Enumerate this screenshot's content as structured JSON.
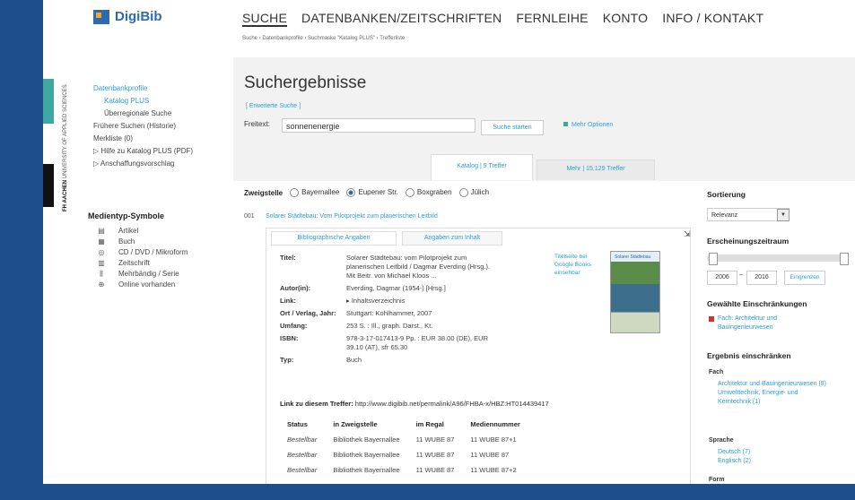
{
  "logo": {
    "text": "DigiBib"
  },
  "nav": {
    "items": [
      "SUCHE",
      "DATENBANKEN/ZEITSCHRIFTEN",
      "FERNLEIHE",
      "KONTO",
      "INFO / KONTAKT"
    ],
    "breadcrumb": "Suche › Datenbankprofile › Suchmaske \"Katalog PLUS\" › Trefferliste"
  },
  "sidebar": {
    "vertical_label": "UNIVERSITY OF APPLIED SCIENCES",
    "vertical_fh": "FH AACHEN",
    "links": [
      {
        "label": "Datenbankprofile",
        "style": "lnk"
      },
      {
        "label": "Katalog PLUS",
        "style": "lnk indent"
      },
      {
        "label": "Überregionale Suche",
        "style": "dark indent"
      },
      {
        "label": "Frühere Suchen (Historie)",
        "style": "dark"
      },
      {
        "label": "Merkliste (0)",
        "style": "dark"
      },
      {
        "label": "▷ Hilfe zu Katalog PLUS (PDF)",
        "style": "dark"
      },
      {
        "label": "▷ Anschaffungsvorschlag",
        "style": "dark"
      }
    ],
    "media_title": "Medientyp-Symbole",
    "media": [
      {
        "icon": "▤",
        "label": "Artikel"
      },
      {
        "icon": "▦",
        "label": "Buch"
      },
      {
        "icon": "◎",
        "label": "CD / DVD / Mikroform"
      },
      {
        "icon": "▥",
        "label": "Zeitschrift"
      },
      {
        "icon": "⫼",
        "label": "Mehrbändig / Serie"
      },
      {
        "icon": "⊕",
        "label": "Online vorhanden"
      }
    ]
  },
  "main": {
    "title": "Suchergebnisse",
    "extended_link": "[ Erweiterte Suche ]",
    "freitext_label": "Freitext:",
    "freitext_value": "sonnenenergie",
    "search_button": "Suche starten",
    "more_options": "Mehr Optionen",
    "tab_katalog": "Katalog | 9 Treffer",
    "tab_mehr": "Mehr | 15.129 Treffer",
    "zweig_label": "Zweigstelle",
    "branches": [
      {
        "label": "Bayernallee",
        "checked": false
      },
      {
        "label": "Eupener Str.",
        "checked": true
      },
      {
        "label": "Boxgraben",
        "checked": false
      },
      {
        "label": "Jülich",
        "checked": false
      }
    ]
  },
  "result": {
    "number": "001",
    "title": "Solarer Städtebau: Vom Pilotprojekt zum planerischen Leitbild",
    "subtab_biblio": "Bibliographische Angaben",
    "subtab_inhalt": "Angaben zum Inhalt",
    "inhalt_link": "Titelseite bei Google Books einsehbar",
    "cover_title": "Solarer Städtebau",
    "details": [
      {
        "label": "Titel:",
        "value": "Solarer Städtebau: vom Pilotprojekt zum planerischen Leitbild / Dagmar Everding (Hrsg.). Mit Beitr. von Michael Kloos ..."
      },
      {
        "label": "Autor(in):",
        "value": "Everding, Dagmar (1954-) [Hrsg.]"
      },
      {
        "label": "Link:",
        "value": "▸ Inhaltsverzeichnis"
      },
      {
        "label": "Ort / Verlag, Jahr:",
        "value": "Stuttgart: Kohlhammer, 2007"
      },
      {
        "label": "Umfang:",
        "value": "253 S. : Ill., graph. Darst., Kt."
      },
      {
        "label": "ISBN:",
        "value": "978-3-17-017413-9 Pp. : EUR 38.00 (DE), EUR 39.10 (AT), sfr 65.30"
      },
      {
        "label": "Typ:",
        "value": "Buch"
      }
    ],
    "permalink_label": "Link zu diesem Treffer:",
    "permalink_url": "http://www.digibib.net/permalink/A96/FHBA-x/HBZ:HT014439417",
    "holdings_headers": [
      "Status",
      "in Zweigstelle",
      "im Regal",
      "Mediennummer"
    ],
    "holdings": [
      [
        "Bestellbar",
        "Bibliothek Bayernallee",
        "11 WUBE 87",
        "11 WUBE 87+1"
      ],
      [
        "Bestellbar",
        "Bibliothek Bayernallee",
        "11 WUBE 87",
        "11 WUBE 87"
      ],
      [
        "Bestellbar",
        "Bibliothek Bayernallee",
        "11 WUBE 87",
        "11 WUBE 87+2"
      ]
    ]
  },
  "right": {
    "sort_title": "Sortierung",
    "sort_value": "Relevanz",
    "period_title": "Erscheinungszeitraum",
    "year_from": "2006",
    "year_dash": "–",
    "year_to": "2016",
    "apply": "Eingrenzen",
    "chosen_title": "Gewählte Einschränkungen",
    "chosen_item": "Fach: Architektur und Bauingenieurwesen",
    "narrow_title": "Ergebnis einschränken",
    "fach_label": "Fach",
    "fach_items": "Architektur und Bauingenieurwesen (8) Umwelttechnik, Energie- und Kerntechnik (1)",
    "sprache_label": "Sprache",
    "sprache_items": "Deutsch (7) Englisch (2)",
    "form_label": "Form"
  }
}
